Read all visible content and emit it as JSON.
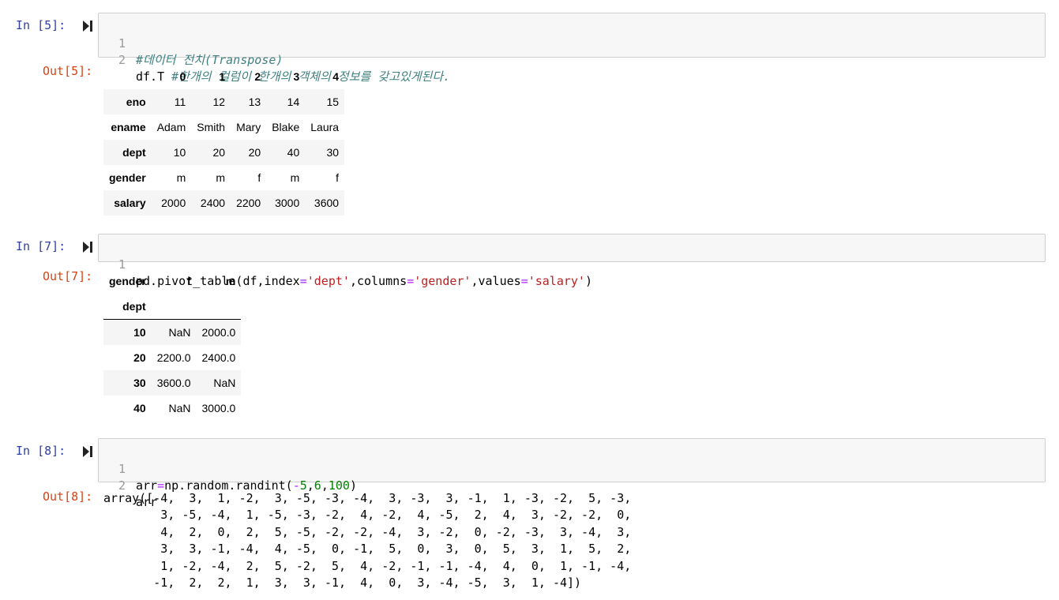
{
  "cells": [
    {
      "in_prompt": "In [5]:",
      "lines": [
        {
          "num": "1",
          "tokens": [
            {
              "t": "#데이터 전치(Transpose)",
              "c": "comment"
            }
          ]
        },
        {
          "num": "2",
          "tokens": [
            {
              "t": "df.T ",
              "c": ""
            },
            {
              "t": "#한개의 컬럼이 한개의 객체의 정보를 갖고있게된다.",
              "c": "comment"
            }
          ]
        }
      ],
      "out_prompt": "Out[5]:",
      "table": {
        "header": [
          "",
          "0",
          "1",
          "2",
          "3",
          "4"
        ],
        "rows": [
          [
            "eno",
            "11",
            "12",
            "13",
            "14",
            "15"
          ],
          [
            "ename",
            "Adam",
            "Smith",
            "Mary",
            "Blake",
            "Laura"
          ],
          [
            "dept",
            "10",
            "20",
            "20",
            "40",
            "30"
          ],
          [
            "gender",
            "m",
            "m",
            "f",
            "m",
            "f"
          ],
          [
            "salary",
            "2000",
            "2400",
            "2200",
            "3000",
            "3600"
          ]
        ]
      }
    },
    {
      "in_prompt": "In [7]:",
      "lines": [
        {
          "num": "1",
          "tokens": [
            {
              "t": "pd.pivot_table(df,index",
              "c": ""
            },
            {
              "t": "=",
              "c": "op"
            },
            {
              "t": "'dept'",
              "c": "str"
            },
            {
              "t": ",columns",
              "c": ""
            },
            {
              "t": "=",
              "c": "op"
            },
            {
              "t": "'gender'",
              "c": "str"
            },
            {
              "t": ",values",
              "c": ""
            },
            {
              "t": "=",
              "c": "op"
            },
            {
              "t": "'salary'",
              "c": "str"
            },
            {
              "t": ")",
              "c": ""
            }
          ]
        }
      ],
      "out_prompt": "Out[7]:",
      "table": {
        "columns_name": "gender",
        "index_name": "dept",
        "header": [
          "f",
          "m"
        ],
        "rows": [
          [
            "10",
            "NaN",
            "2000.0"
          ],
          [
            "20",
            "2200.0",
            "2400.0"
          ],
          [
            "30",
            "3600.0",
            "NaN"
          ],
          [
            "40",
            "NaN",
            "3000.0"
          ]
        ]
      }
    },
    {
      "in_prompt": "In [8]:",
      "lines": [
        {
          "num": "1",
          "tokens": [
            {
              "t": "arr",
              "c": ""
            },
            {
              "t": "=",
              "c": "op"
            },
            {
              "t": "np.random.randint(",
              "c": ""
            },
            {
              "t": "-",
              "c": "op"
            },
            {
              "t": "5",
              "c": "num"
            },
            {
              "t": ",",
              "c": ""
            },
            {
              "t": "6",
              "c": "num"
            },
            {
              "t": ",",
              "c": ""
            },
            {
              "t": "100",
              "c": "num"
            },
            {
              "t": ")",
              "c": ""
            }
          ]
        },
        {
          "num": "2",
          "tokens": [
            {
              "t": "arr",
              "c": ""
            }
          ]
        }
      ],
      "out_prompt": "Out[8]:",
      "output_text": "array([-4,  3,  1, -2,  3, -5, -3, -4,  3, -3,  3, -1,  1, -3, -2,  5, -3,\n        3, -5, -4,  1, -5, -3, -2,  4, -2,  4, -5,  2,  4,  3, -2, -2,  0,\n        4,  2,  0,  2,  5, -5, -2, -2, -4,  3, -2,  0, -2, -3,  3, -4,  3,\n        3,  3, -1, -4,  4, -5,  0, -1,  5,  0,  3,  0,  5,  3,  1,  5,  2,\n        1, -2, -4,  2,  5, -2,  5,  4, -2, -1, -1, -4,  4,  0,  1, -1, -4,\n       -1,  2,  2,  1,  3,  3, -1,  4,  0,  3, -4, -5,  3,  1, -4])"
    }
  ]
}
